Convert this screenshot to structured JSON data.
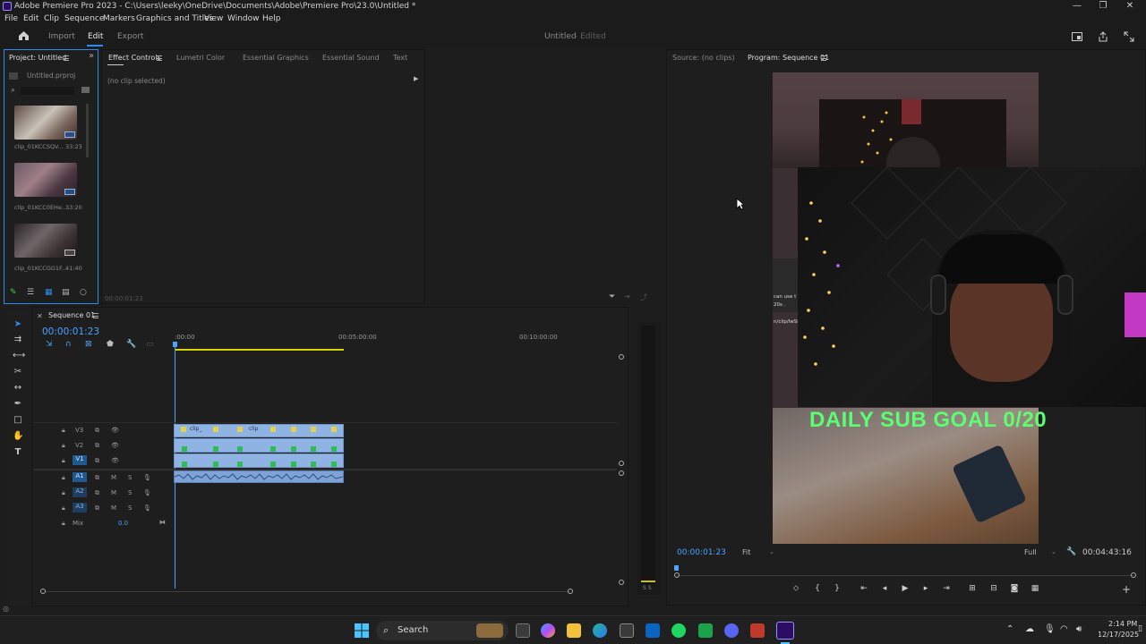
{
  "window": {
    "title": "Adobe Premiere Pro 2023 - C:\\Users\\leeky\\OneDrive\\Documents\\Adobe\\Premiere Pro\\23.0\\Untitled *",
    "controls": [
      "—",
      "❐",
      "✕"
    ]
  },
  "menu": [
    "File",
    "Edit",
    "Clip",
    "Sequence",
    "Markers",
    "Graphics and Titles",
    "View",
    "Window",
    "Help"
  ],
  "workspace": {
    "tabs": [
      "Import",
      "Edit",
      "Export"
    ],
    "active": "Edit",
    "doc_title": "Untitled",
    "doc_status": "- Edited"
  },
  "project_panel": {
    "tab": "Project: Untitled",
    "file": "Untitled.prproj",
    "clips": [
      {
        "name": "clip_01KCCSQV...",
        "duration": "33:23"
      },
      {
        "name": "clip_01KCC0EHe...",
        "duration": "33:20"
      },
      {
        "name": "clip_01KCCGG1F...",
        "duration": "41:40"
      }
    ]
  },
  "effect_panel": {
    "tabs": [
      "Effect Controls",
      "Lumetri Color",
      "Essential Graphics",
      "Essential Sound",
      "Text"
    ],
    "no_clip": "(no clip selected)",
    "timecode": "00:00:01:23"
  },
  "timeline": {
    "tab": "Sequence 01",
    "timecode": "00:00:01:23",
    "ruler": [
      ":00:00",
      "00:05:00:00",
      "00:10:00:00"
    ],
    "video_tracks": [
      "V3",
      "V2",
      "V1"
    ],
    "audio_tracks": [
      "A1",
      "A2",
      "A3"
    ],
    "mix_label": "Mix",
    "mix_value": "0.0",
    "clip_labels": [
      "clip_",
      "clip",
      "clip"
    ],
    "meter_labels": "S S"
  },
  "source_monitor": {
    "tab": "Source: (no clips)"
  },
  "program_monitor": {
    "tab": "Program: Sequence 01",
    "timecode": "00:00:01:23",
    "fit": "Fit",
    "quality": "Full",
    "duration": "00:04:43:16",
    "overlay_text": "DAILY SUB GOAL 0/20",
    "chat_text": [
      "can use t",
      "20s .",
      "n/clip/lwSl"
    ],
    "transport": [
      "⬦",
      "{",
      "}",
      "⇤",
      "◂",
      "▶",
      "▸",
      "⇥",
      "⊞",
      "⊟",
      "◙",
      "▦"
    ]
  },
  "taskbar": {
    "search": "Search",
    "time": "2:14 PM",
    "date": "12/17/2025"
  },
  "colors": {
    "accent": "#2d8ceb",
    "timecode_blue": "#4aa3ff",
    "overlay_green": "#5bff72",
    "clip_blue": "#8fb3e3"
  }
}
